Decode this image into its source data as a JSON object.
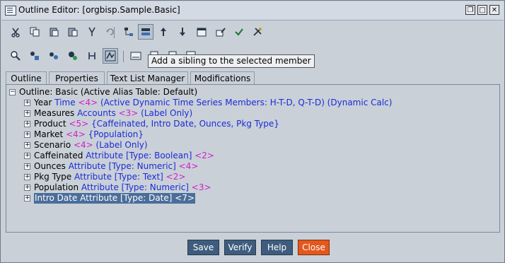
{
  "window": {
    "title": "Outline Editor: [orgbisp.Sample.Basic]",
    "controls": [
      "restore-icon",
      "maximize-icon",
      "close-icon"
    ]
  },
  "toolbar1": {
    "icons": [
      "cut-icon",
      "copy-icon",
      "paste-icon",
      "paste-sibling-icon",
      "find-icon",
      "undo-icon",
      "add-child-icon",
      "add-sibling-icon",
      "move-up-icon",
      "move-down-icon",
      "calendar-icon",
      "edit-icon",
      "verify-check-icon",
      "tools-icon"
    ],
    "pressed_index": 7
  },
  "toolbar2": {
    "icons": [
      "zoom-out-icon",
      "alias-icon",
      "member-icon",
      "properties-icon",
      "attribute-icon",
      "formula-icon",
      "text-abc-icon",
      "doc-icon",
      "doc2-icon",
      "doc3-icon"
    ],
    "pressed_index": 5
  },
  "tooltip": {
    "text": "Add a sibling to the selected member"
  },
  "tabs": [
    {
      "label": "Outline",
      "active": true
    },
    {
      "label": "Properties",
      "active": false
    },
    {
      "label": "Text List Manager",
      "active": false
    },
    {
      "label": "Modifications",
      "active": false
    }
  ],
  "outline": {
    "root": {
      "expander": "−",
      "text": "Outline: Basic (Active Alias Table: Default)"
    },
    "members": [
      {
        "expander": "+",
        "parts": [
          {
            "t": "Year ",
            "c": "k"
          },
          {
            "t": "Time ",
            "c": "b"
          },
          {
            "t": "<4> ",
            "c": "m"
          },
          {
            "t": "(Active Dynamic Time Series Members: H-T-D, Q-T-D) (Dynamic Calc)",
            "c": "b"
          }
        ]
      },
      {
        "expander": "+",
        "parts": [
          {
            "t": "Measures ",
            "c": "k"
          },
          {
            "t": "Accounts ",
            "c": "b"
          },
          {
            "t": "<3> ",
            "c": "m"
          },
          {
            "t": "(Label Only)",
            "c": "b"
          }
        ]
      },
      {
        "expander": "+",
        "parts": [
          {
            "t": "Product ",
            "c": "k"
          },
          {
            "t": "<5> ",
            "c": "m"
          },
          {
            "t": "{Caffeinated, Intro Date, Ounces, Pkg Type}",
            "c": "b"
          }
        ]
      },
      {
        "expander": "+",
        "parts": [
          {
            "t": "Market ",
            "c": "k"
          },
          {
            "t": "<4> ",
            "c": "m"
          },
          {
            "t": "{Population}",
            "c": "b"
          }
        ]
      },
      {
        "expander": "+",
        "parts": [
          {
            "t": "Scenario ",
            "c": "k"
          },
          {
            "t": "<4> ",
            "c": "m"
          },
          {
            "t": "(Label Only)",
            "c": "b"
          }
        ]
      },
      {
        "expander": "+",
        "parts": [
          {
            "t": "Caffeinated ",
            "c": "k"
          },
          {
            "t": "Attribute [Type: Boolean] ",
            "c": "b"
          },
          {
            "t": "<2>",
            "c": "m"
          }
        ]
      },
      {
        "expander": "+",
        "parts": [
          {
            "t": "Ounces ",
            "c": "k"
          },
          {
            "t": "Attribute [Type: Numeric] ",
            "c": "b"
          },
          {
            "t": "<4>",
            "c": "m"
          }
        ]
      },
      {
        "expander": "+",
        "parts": [
          {
            "t": "Pkg Type ",
            "c": "k"
          },
          {
            "t": "Attribute [Type: Text] ",
            "c": "b"
          },
          {
            "t": "<2>",
            "c": "m"
          }
        ]
      },
      {
        "expander": "+",
        "parts": [
          {
            "t": "Population ",
            "c": "k"
          },
          {
            "t": "Attribute [Type: Numeric] ",
            "c": "b"
          },
          {
            "t": "<3>",
            "c": "m"
          }
        ]
      },
      {
        "expander": "+",
        "selected": true,
        "parts": [
          {
            "t": "Intro Date Attribute [Type: Date] <7>",
            "c": "k"
          }
        ]
      }
    ]
  },
  "buttons": {
    "save": "Save",
    "verify": "Verify",
    "help": "Help",
    "close": "Close"
  },
  "colors": {
    "member_name": "#000000",
    "dimension_type": "#1d2bd6",
    "member_count": "#d41ec9",
    "selection": "#4a6d9a",
    "close_button": "#e2581e",
    "action_button": "#3e5c7e"
  }
}
